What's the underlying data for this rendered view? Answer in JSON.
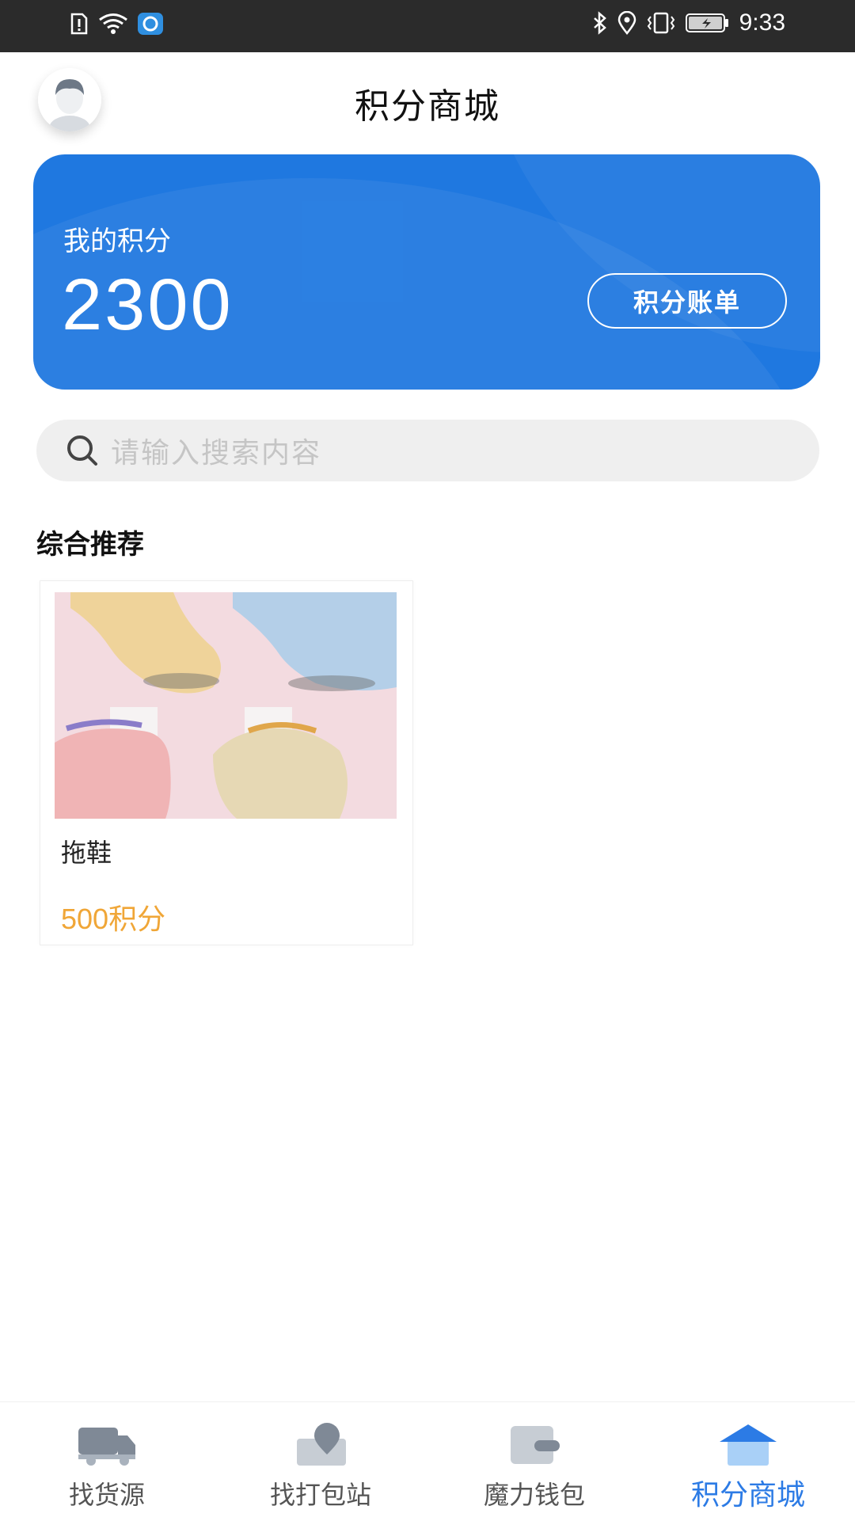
{
  "status_bar": {
    "time": "9:33",
    "icons": [
      "sim-alert-icon",
      "wifi-icon",
      "app-notification-icon",
      "bluetooth-icon",
      "location-icon",
      "vibrate-icon",
      "battery-charging-icon"
    ]
  },
  "header": {
    "title": "积分商城",
    "avatar_icon": "user-avatar-icon"
  },
  "points_card": {
    "label": "我的积分",
    "value": "2300",
    "bill_button": "积分账单",
    "color": "#1f78e0"
  },
  "search": {
    "placeholder": "请输入搜索内容",
    "icon": "search-icon"
  },
  "section": {
    "title": "综合推荐"
  },
  "products": [
    {
      "name": "拖鞋",
      "price": "500积分",
      "image_icon": "socks-image"
    }
  ],
  "tabbar": {
    "items": [
      {
        "label": "找货源",
        "icon": "truck-icon",
        "active": false
      },
      {
        "label": "找打包站",
        "icon": "map-pin-icon",
        "active": false
      },
      {
        "label": "魔力钱包",
        "icon": "wallet-icon",
        "active": false
      },
      {
        "label": "积分商城",
        "icon": "store-icon",
        "active": true
      }
    ],
    "active_color": "#2c7be5"
  }
}
